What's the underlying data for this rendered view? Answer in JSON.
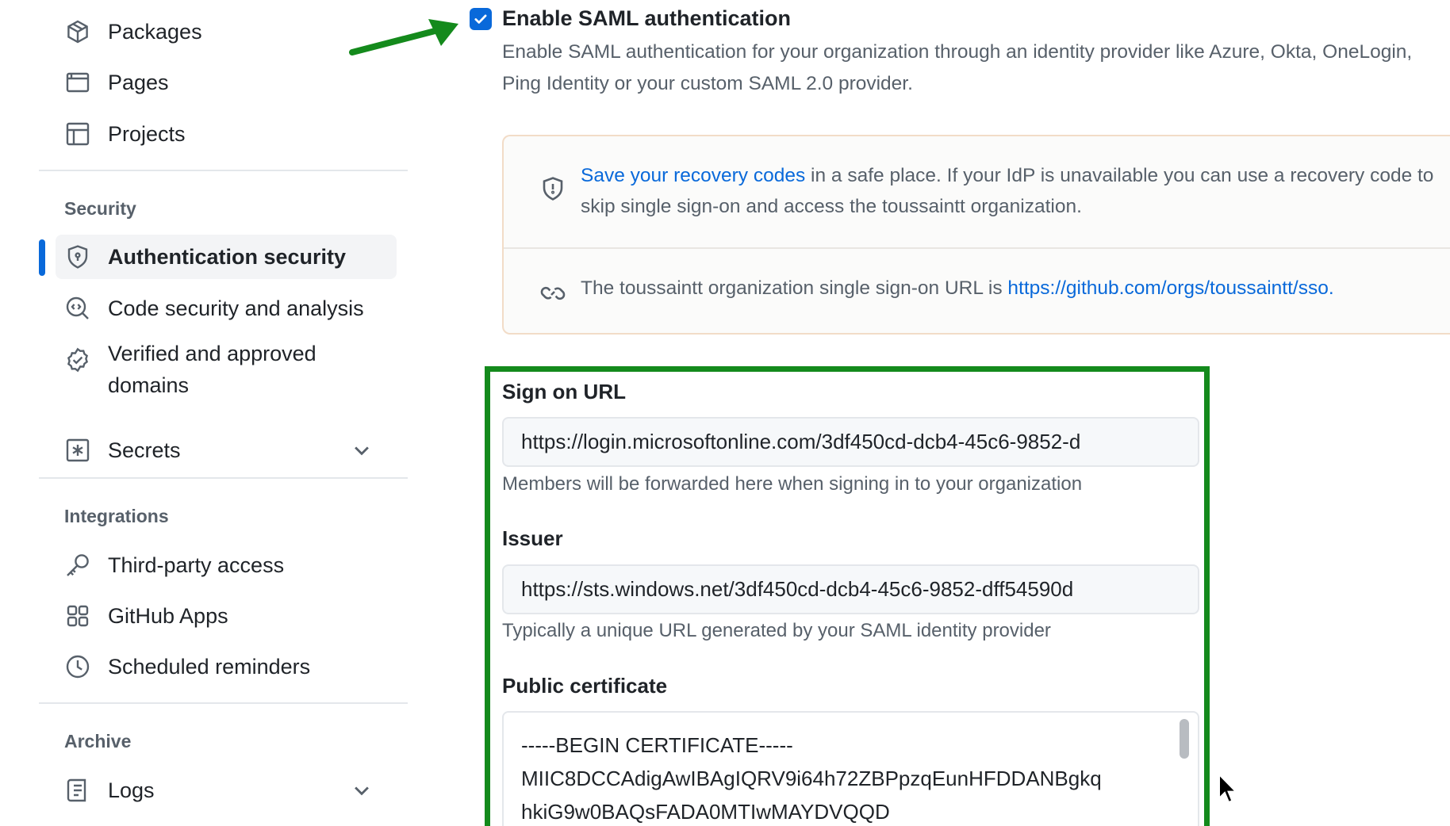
{
  "sidebar": {
    "items_top": [
      {
        "label": "Packages",
        "icon": "package-icon"
      },
      {
        "label": "Pages",
        "icon": "browser-icon"
      },
      {
        "label": "Projects",
        "icon": "table-icon"
      }
    ],
    "security": {
      "heading": "Security",
      "items": [
        {
          "label": "Authentication security",
          "icon": "shield-lock-icon",
          "active": true
        },
        {
          "label": "Code security and analysis",
          "icon": "codescan-icon"
        },
        {
          "label": "Verified and approved domains",
          "icon": "verified-icon"
        },
        {
          "label": "Secrets",
          "icon": "asterisk-icon",
          "expandable": true
        }
      ]
    },
    "integrations": {
      "heading": "Integrations",
      "items": [
        {
          "label": "Third-party access",
          "icon": "key-icon"
        },
        {
          "label": "GitHub Apps",
          "icon": "apps-icon"
        },
        {
          "label": "Scheduled reminders",
          "icon": "clock-icon"
        }
      ]
    },
    "archive": {
      "heading": "Archive",
      "items": [
        {
          "label": "Logs",
          "icon": "log-icon",
          "expandable": true
        }
      ]
    }
  },
  "saml": {
    "enabled": true,
    "title": "Enable SAML authentication",
    "description": "Enable SAML authentication for your organization through an identity provider like Azure, Okta, OneLogin, Ping Identity or your custom SAML 2.0 provider."
  },
  "flash": {
    "recovery_link": "Save your recovery codes",
    "recovery_text": " in a safe place. If your IdP is unavailable you can use a recovery code to skip single sign-on and access the toussaintt organization.",
    "sso_text": "The toussaintt organization single sign-on URL is ",
    "sso_url": "https://github.com/orgs/toussaintt/sso."
  },
  "form": {
    "sign_on_url": {
      "label": "Sign on URL",
      "value": "https://login.microsoftonline.com/3df450cd-dcb4-45c6-9852-d",
      "hint": "Members will be forwarded here when signing in to your organization"
    },
    "issuer": {
      "label": "Issuer",
      "value": "https://sts.windows.net/3df450cd-dcb4-45c6-9852-dff54590d",
      "hint": "Typically a unique URL generated by your SAML identity provider"
    },
    "public_certificate": {
      "label": "Public certificate",
      "value": "-----BEGIN CERTIFICATE-----\nMIIC8DCCAdigAwIBAgIQRV9i64h72ZBPpzqEunHFDDANBgkq\nhkiG9w0BAQsFADA0MTIwMAYDVQQD"
    }
  },
  "colors": {
    "accent": "#0969da",
    "annotation_green": "#148a1c",
    "flash_border": "#f2dcc7"
  }
}
